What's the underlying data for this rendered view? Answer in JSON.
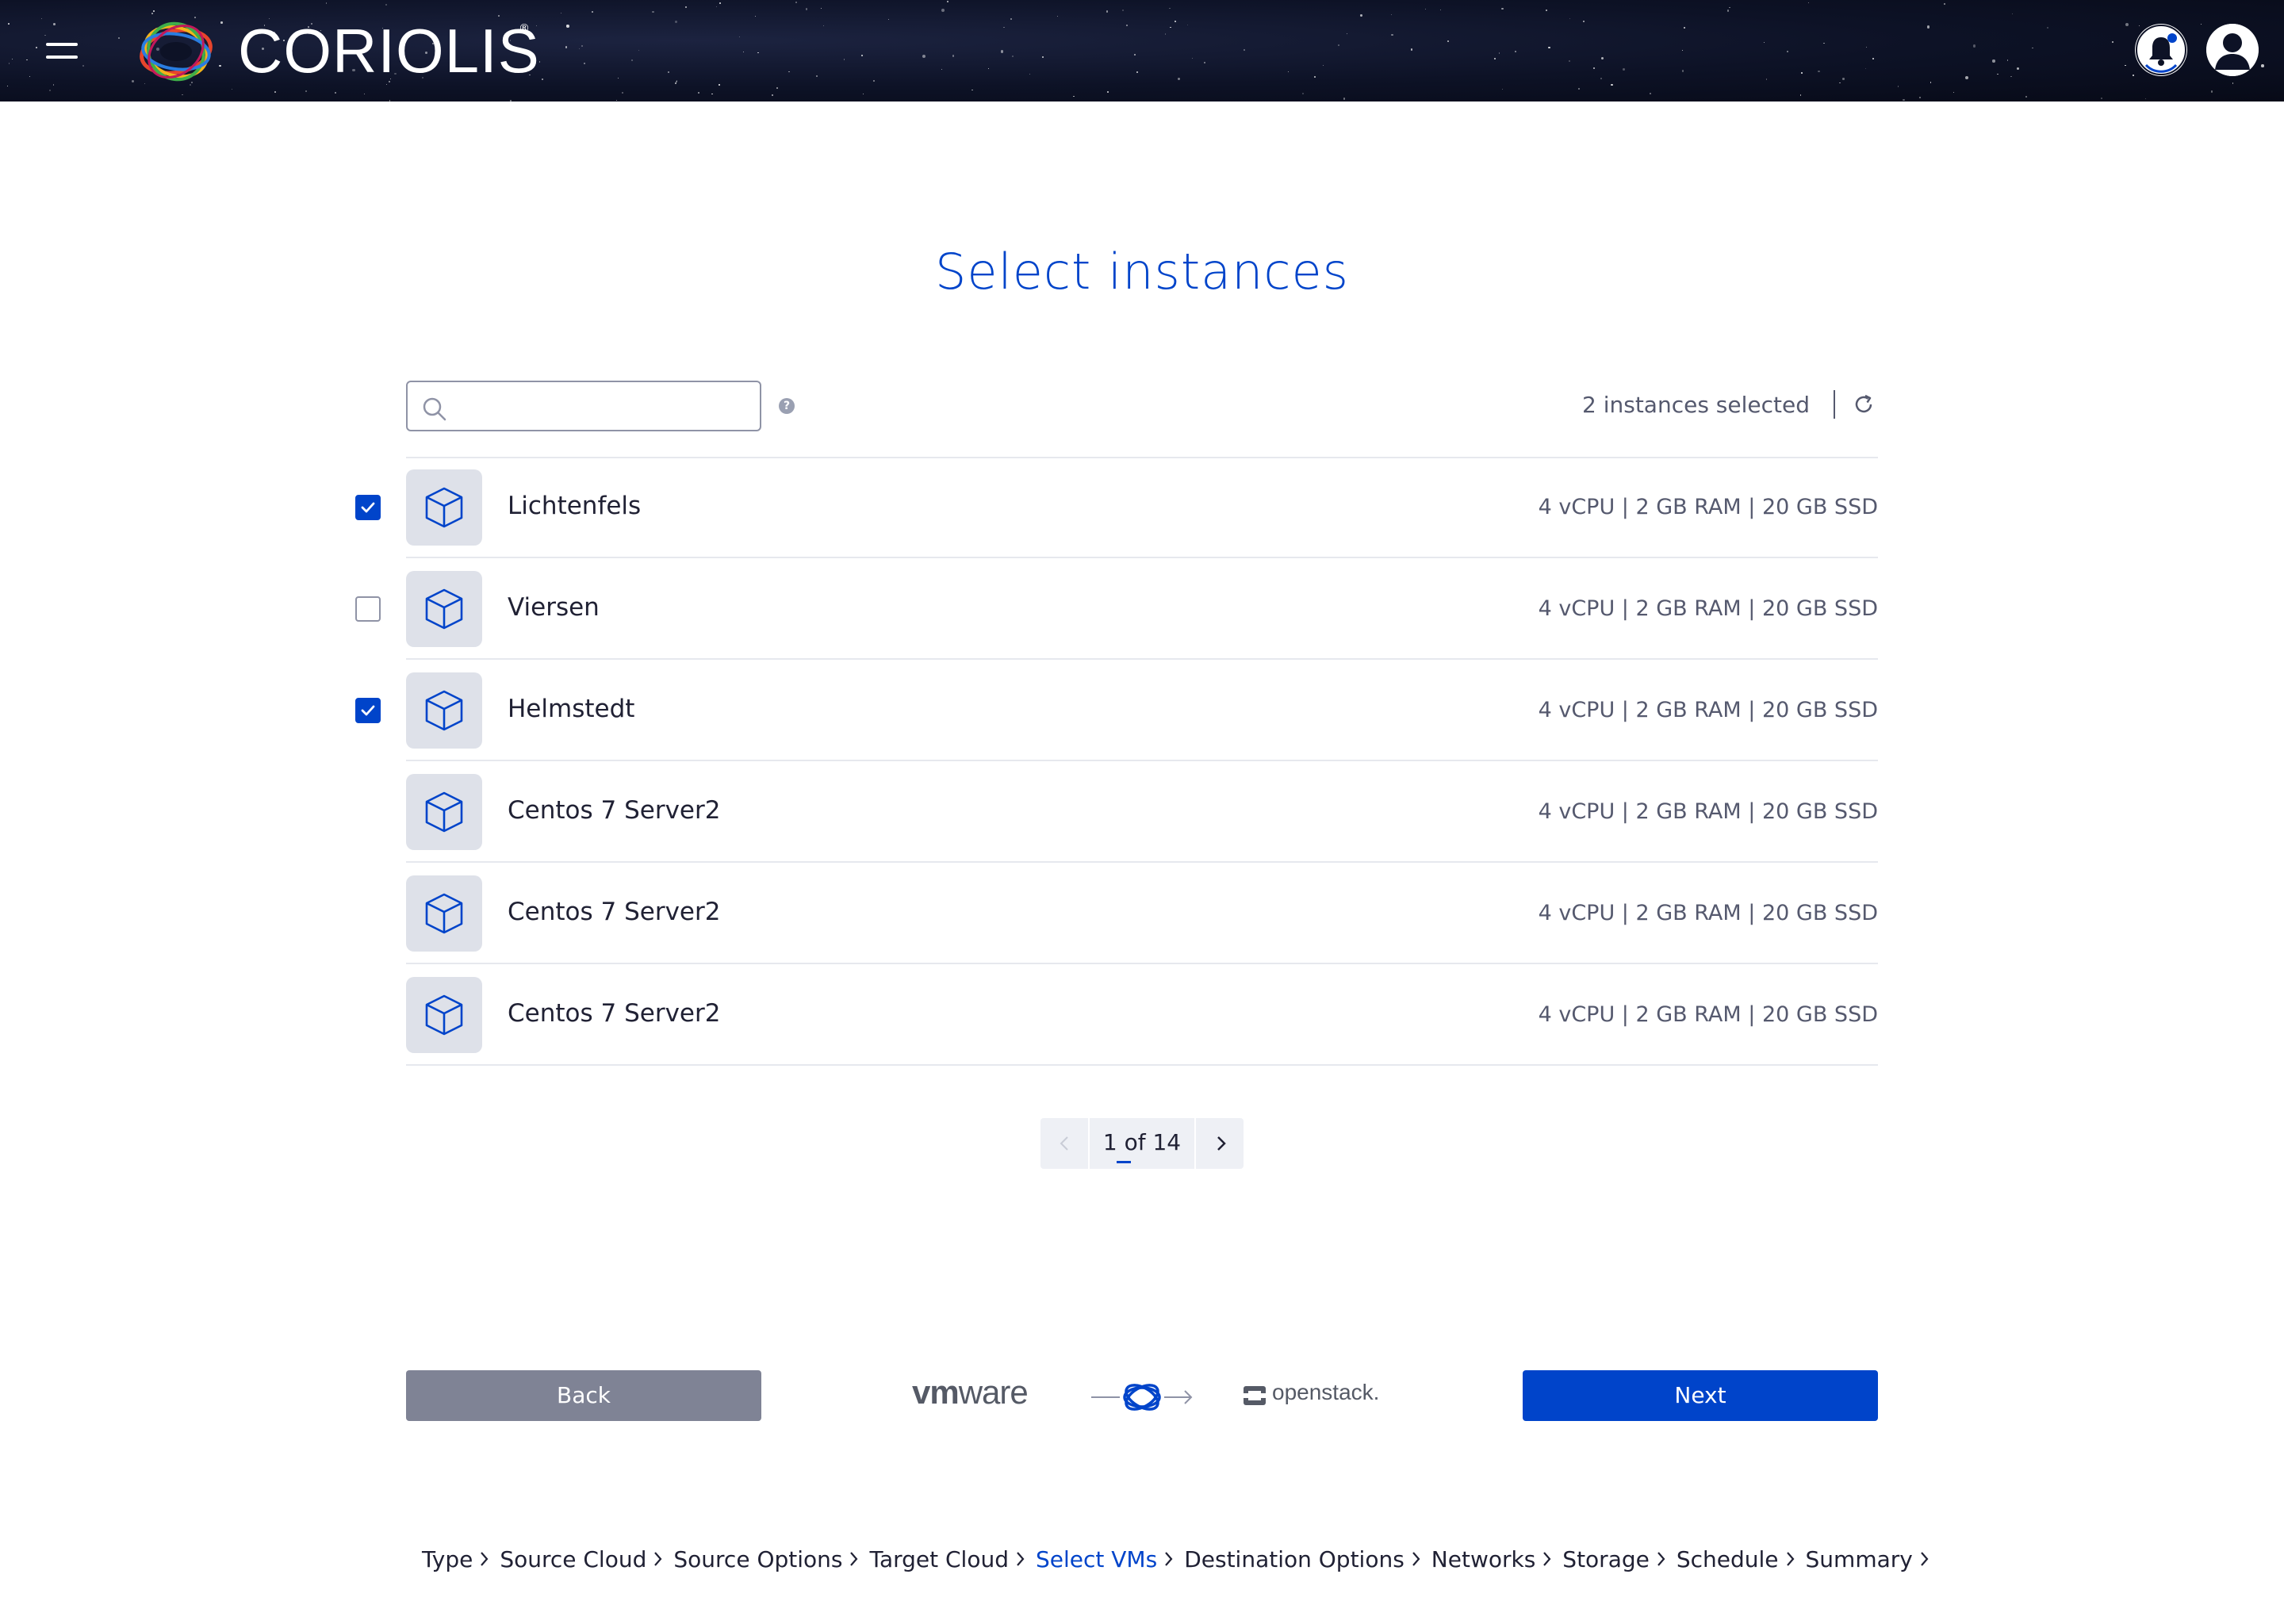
{
  "header": {
    "app_name": "CORIOLIS",
    "registered_mark": "®",
    "menu_icon": "hamburger-icon",
    "notifications_icon": "bell-icon",
    "user_icon": "user-avatar-icon"
  },
  "page": {
    "title": "Select instances"
  },
  "search": {
    "placeholder": "",
    "value": "",
    "icon": "search-icon",
    "help_icon": "help-icon",
    "help_glyph": "?"
  },
  "selection": {
    "count_text": "2 instances selected",
    "refresh_icon": "refresh-icon"
  },
  "instances": [
    {
      "name": "Lichtenfels",
      "specs": "4 vCPU | 2 GB RAM | 20 GB SSD",
      "checked": true,
      "checkbox_visible": true
    },
    {
      "name": "Viersen",
      "specs": "4 vCPU | 2 GB RAM | 20 GB SSD",
      "checked": false,
      "checkbox_visible": true
    },
    {
      "name": "Helmstedt",
      "specs": "4 vCPU | 2 GB RAM | 20 GB SSD",
      "checked": true,
      "checkbox_visible": true
    },
    {
      "name": "Centos 7 Server2",
      "specs": "4 vCPU | 2 GB RAM | 20 GB SSD",
      "checked": false,
      "checkbox_visible": false
    },
    {
      "name": "Centos 7 Server2",
      "specs": "4 vCPU | 2 GB RAM | 20 GB SSD",
      "checked": false,
      "checkbox_visible": false
    },
    {
      "name": "Centos 7 Server2",
      "specs": "4 vCPU | 2 GB RAM | 20 GB SSD",
      "checked": false,
      "checkbox_visible": false
    }
  ],
  "pagination": {
    "label": "1 of 14",
    "prev_icon": "chevron-left-icon",
    "next_icon": "chevron-right-icon"
  },
  "footer": {
    "back_label": "Back",
    "next_label": "Next",
    "source_logo_vm": "vm",
    "source_logo_ware": "ware",
    "target_logo": "openstack."
  },
  "breadcrumb": [
    {
      "label": "Type",
      "active": false
    },
    {
      "label": "Source Cloud",
      "active": false
    },
    {
      "label": "Source Options",
      "active": false
    },
    {
      "label": "Target Cloud",
      "active": false
    },
    {
      "label": "Select VMs",
      "active": true
    },
    {
      "label": "Destination Options",
      "active": false
    },
    {
      "label": "Networks",
      "active": false
    },
    {
      "label": "Storage",
      "active": false
    },
    {
      "label": "Schedule",
      "active": false
    },
    {
      "label": "Summary",
      "active": false
    }
  ],
  "colors": {
    "accent": "#0044CA",
    "text": "#202134",
    "muted": "#55596e",
    "back_button": "#7f8395",
    "icon_bg": "#dee1e9"
  }
}
